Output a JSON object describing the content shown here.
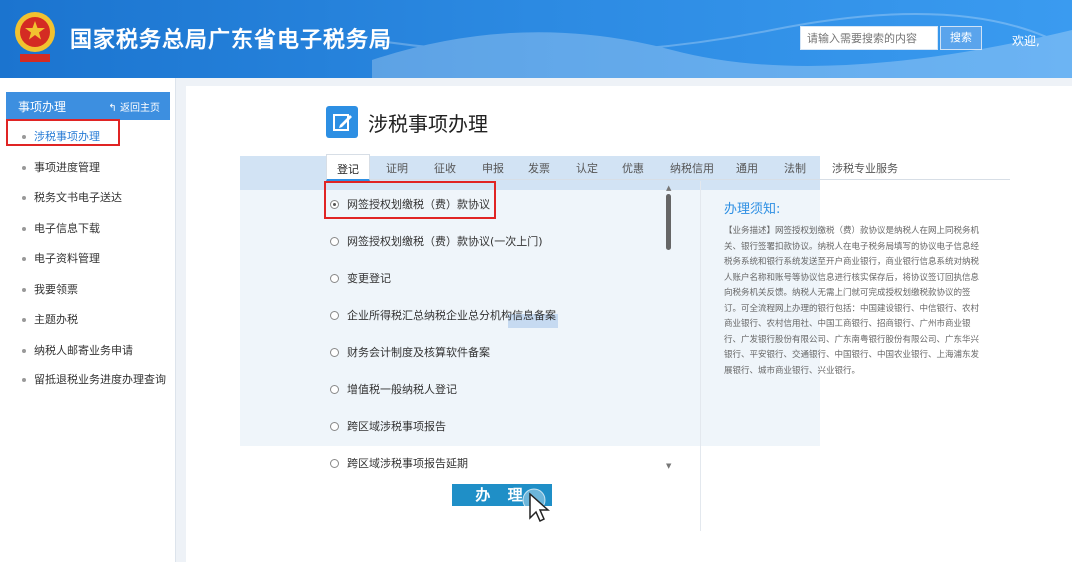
{
  "header": {
    "title": "国家税务总局广东省电子税务局",
    "search_placeholder": "请输入需要搜索的内容",
    "search_button": "搜索",
    "welcome": "欢迎,"
  },
  "sidebar": {
    "title": "事项办理",
    "back_label": "返回主页",
    "items": [
      {
        "label": "涉税事项办理"
      },
      {
        "label": "事项进度管理"
      },
      {
        "label": "税务文书电子送达"
      },
      {
        "label": "电子信息下载"
      },
      {
        "label": "电子资料管理"
      },
      {
        "label": "我要领票"
      },
      {
        "label": "主题办税"
      },
      {
        "label": "纳税人邮寄业务申请"
      },
      {
        "label": "留抵退税业务进度办理查询"
      }
    ]
  },
  "main": {
    "title": "涉税事项办理",
    "tabs": [
      "登记",
      "证明",
      "征收",
      "申报",
      "发票",
      "认定",
      "优惠",
      "纳税信用",
      "通用",
      "法制",
      "涉税专业服务"
    ],
    "options": [
      {
        "label": "网签授权划缴税（费）款协议",
        "selected": true
      },
      {
        "label": "网签授权划缴税（费）款协议(一次上门)",
        "selected": false
      },
      {
        "label": "变更登记",
        "selected": false
      },
      {
        "label": "企业所得税汇总纳税企业总分机构信息备案",
        "selected": false
      },
      {
        "label": "财务会计制度及核算软件备案",
        "selected": false
      },
      {
        "label": "增值税一般纳税人登记",
        "selected": false
      },
      {
        "label": "跨区域涉税事项报告",
        "selected": false
      },
      {
        "label": "跨区域涉税事项报告延期",
        "selected": false
      }
    ],
    "do_button": "办 理",
    "notice_title": "办理须知:",
    "notice_text": "【业务描述】网签授权划缴税（费）款协议是纳税人在网上同税务机关、银行签署扣款协议。纳税人在电子税务局填写的协议电子信息经税务系统和银行系统发送至开户商业银行，商业银行信息系统对纳税人账户名称和账号等协议信息进行核实保存后，将协议签订回执信息向税务机关反馈。纳税人无需上门就可完成授权划缴税款协议的签订。可全流程网上办理的银行包括：中国建设银行、中信银行、农村商业银行、农村信用社、中国工商银行、招商银行、广州市商业银行、广发银行股份有限公司、广东南粤银行股份有限公司、广东华兴银行、平安银行、交通银行、中国银行、中国农业银行、上海浦东发展银行、城市商业银行、兴业银行。"
  },
  "colors": {
    "header_blue": "#2c8ae2",
    "accent": "#2d8fe3",
    "highlight_red": "#e02424",
    "do_button": "#1f8fc7"
  },
  "icons": {
    "logo": "tax-emblem-icon",
    "back": "back-arrow-icon",
    "page": "edit-icon",
    "cursor": "mouse-pointer-icon"
  }
}
